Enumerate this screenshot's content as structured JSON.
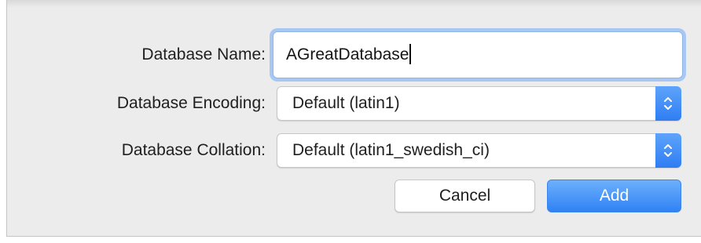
{
  "form": {
    "name_label": "Database Name:",
    "name_value": "AGreatDatabase",
    "encoding_label": "Database Encoding:",
    "encoding_value": "Default (latin1)",
    "collation_label": "Database Collation:",
    "collation_value": "Default (latin1_swedish_ci)"
  },
  "buttons": {
    "cancel_label": "Cancel",
    "add_label": "Add"
  },
  "icons": {
    "popup_stepper": "up-down-chevron-icon"
  },
  "colors": {
    "accent": "#2f82f5",
    "focus_ring": "#a8c8f3",
    "background": "#ececec"
  }
}
